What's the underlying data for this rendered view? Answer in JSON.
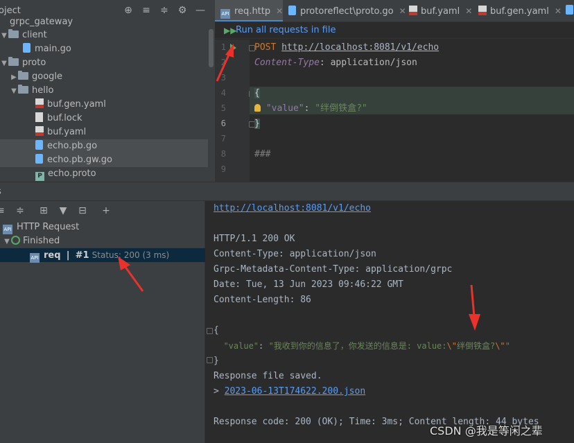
{
  "project": {
    "title": "oject",
    "tree": [
      {
        "label": "grpc_gateway",
        "type": "folder"
      },
      {
        "label": "client",
        "type": "folder"
      },
      {
        "label": "main.go",
        "type": "go"
      },
      {
        "label": "proto",
        "type": "folder"
      },
      {
        "label": "google",
        "type": "folder"
      },
      {
        "label": "hello",
        "type": "folder"
      },
      {
        "label": "buf.gen.yaml",
        "type": "yaml"
      },
      {
        "label": "buf.lock",
        "type": "file"
      },
      {
        "label": "buf.yaml",
        "type": "yaml"
      },
      {
        "label": "echo.pb.go",
        "type": "go"
      },
      {
        "label": "echo.pb.gw.go",
        "type": "go"
      },
      {
        "label": "echo.proto",
        "type": "proto"
      }
    ]
  },
  "editor": {
    "tabs": [
      {
        "label": "req.http",
        "active": true
      },
      {
        "label": "protoreflect\\proto.go",
        "active": false
      },
      {
        "label": "buf.yaml",
        "active": false
      },
      {
        "label": "buf.gen.yaml",
        "active": false
      }
    ],
    "run_all_label": "Run all requests in file",
    "line_numbers": [
      "1",
      "2",
      "3",
      "4",
      "5",
      "6",
      "7",
      "8",
      "9"
    ],
    "method": "POST",
    "url": "http://localhost:8081/v1/echo",
    "header_name": "Content-Type",
    "header_sep": ":",
    "header_value": " application/json",
    "open_brace": "{",
    "body_key": "\"value\"",
    "body_colon": ": ",
    "body_value": "\"绊倒铁盒?\"",
    "close_brace": "}",
    "separator": "###"
  },
  "services": {
    "title": "s",
    "root_label": "HTTP Request",
    "finished_label": "Finished",
    "req_name": "req",
    "req_sep": "|",
    "req_run": "#1",
    "req_status": "Status: 200 (3 ms)"
  },
  "response": {
    "url": "http://localhost:8081/v1/echo",
    "status_line": "HTTP/1.1 200 OK",
    "headers": [
      "Content-Type: application/json",
      "Grpc-Metadata-Content-Type: application/grpc",
      "Date: Tue, 13 Jun 2023 09:46:22 GMT",
      "Content-Length: 86"
    ],
    "open_brace": "{",
    "body_key": "\"value\"",
    "body_colon": ": ",
    "body_value_start": "\"我收到你的信息了，你发送的信息是: value:",
    "body_esc1": "\\\"",
    "body_value_mid": "绊倒铁盒?",
    "body_esc2": "\\\"",
    "body_value_end": "\"",
    "close_brace": "}",
    "saved_text": "Response file saved.",
    "saved_prefix": "> ",
    "saved_file": "2023-06-13T174622.200.json",
    "summary": "Response code: 200 (OK); Time: 3ms; Content length: 44 bytes"
  },
  "watermark": "CSDN @我是等闲之辈",
  "colors": {
    "accent": "#4a88c7",
    "arrow": "#e8322b",
    "run_green": "#59a869"
  }
}
